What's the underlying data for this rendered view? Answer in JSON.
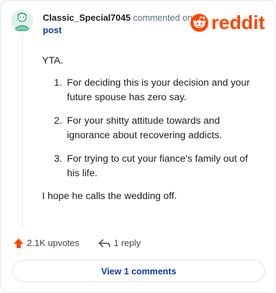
{
  "comment": {
    "username": "Classic_Special7045",
    "action_text": "commented on",
    "post_link": "post",
    "intro": "YTA.",
    "points": [
      "For deciding this is your decision and your future spouse has zero say.",
      "For your shitty attitude towards and ignorance about recovering addicts.",
      "For trying to cut your fiance's family out of his life."
    ],
    "closing": "I hope he calls the wedding off."
  },
  "brand": {
    "logo_text": "reddit",
    "logo_icon": "reddit-snoo-icon",
    "color": "#ff4500"
  },
  "actions": {
    "upvotes_label": "2.1K upvotes",
    "upvote_icon": "upvote-arrow-icon",
    "replies_label": "1 reply",
    "reply_icon": "reply-arrow-icon"
  },
  "footer": {
    "view_comments_label": "View 1 comments"
  },
  "colors": {
    "link": "#0b3aa8",
    "upvote": "#ff4500",
    "border": "#e4e6e8"
  }
}
